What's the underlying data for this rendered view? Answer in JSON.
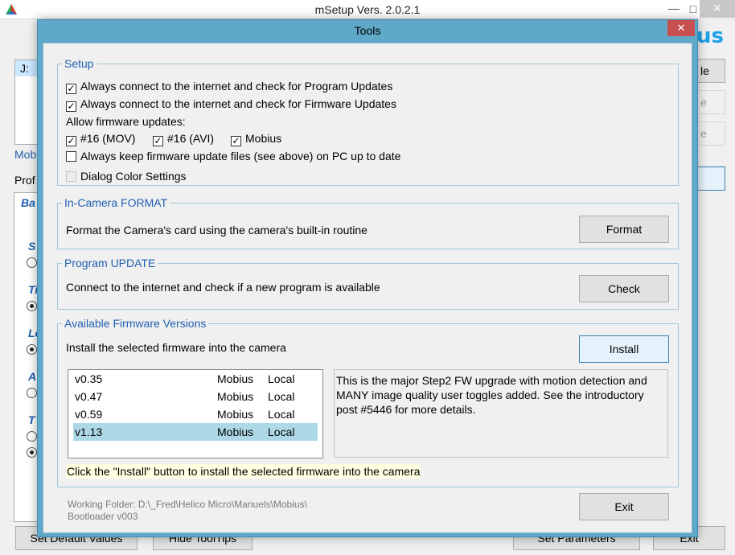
{
  "main_window": {
    "title": "mSetup  Vers. 2.0.2.1",
    "controls": {
      "minimize": "—",
      "maximize": "□",
      "close": "✕"
    },
    "drive_item": "J:",
    "logo_text": "us",
    "mobius_label": "Mobi",
    "profile_label": "Prof",
    "tab_label": "Ba",
    "side_letters": [
      "S",
      "Ti",
      "Lo",
      "A",
      "T"
    ],
    "right_buttons": [
      "le",
      "e",
      "e"
    ],
    "bottom_buttons": [
      "Set Default Values",
      "Hide ToolTips",
      "Set Parameters",
      "Exit"
    ]
  },
  "dialog": {
    "title": "Tools",
    "close_label": "✕",
    "setup": {
      "title": "Setup",
      "options": [
        {
          "label": "Always connect to the internet and check for Program Updates",
          "checked": true
        },
        {
          "label": "Always connect to the internet and check for Firmware Updates",
          "checked": true
        }
      ],
      "allow_label": "Allow firmware updates:",
      "firmware_types": [
        {
          "label": "#16 (MOV)",
          "checked": true
        },
        {
          "label": "#16 (AVI)",
          "checked": true
        },
        {
          "label": "Mobius",
          "checked": true
        }
      ],
      "keep_label": "Always keep firmware update files (see above) on PC up to date",
      "dialog_color_label": "Dialog Color Settings"
    },
    "format": {
      "title": "In-Camera FORMAT",
      "text": "Format the Camera's card using the camera's built-in routine",
      "button": "Format"
    },
    "program_update": {
      "title": "Program UPDATE",
      "text": "Connect to the internet and check if a new program is available",
      "button": "Check"
    },
    "firmware": {
      "title": "Available Firmware Versions",
      "text": "Install the selected firmware into the camera",
      "button": "Install",
      "rows": [
        {
          "version": "v0.35",
          "model": "Mobius",
          "source": "Local"
        },
        {
          "version": "v0.47",
          "model": "Mobius",
          "source": "Local"
        },
        {
          "version": "v0.59",
          "model": "Mobius",
          "source": "Local"
        },
        {
          "version": "v1.13",
          "model": "Mobius",
          "source": "Local"
        }
      ],
      "selected_index": 3,
      "description": "This is the major Step2 FW upgrade with motion detection and MANY image quality user toggles added.  See the introductory post #5446 for more details.",
      "hint": "Click the \"Install\" button to install the selected firmware into the camera"
    },
    "working_folder": "Working Folder: D:\\_Fred\\Helico Micro\\Manuels\\Mobius\\",
    "bootloader": "Bootloader  v003",
    "exit_button": "Exit"
  },
  "colors": {
    "dialog_frame": "#5fa8c8",
    "group_title": "#1f5fb0",
    "selected_row": "#add8e6",
    "hint_bg": "#ffffe1",
    "close_button": "#c74f4f",
    "logo": "#1ea1e6"
  }
}
